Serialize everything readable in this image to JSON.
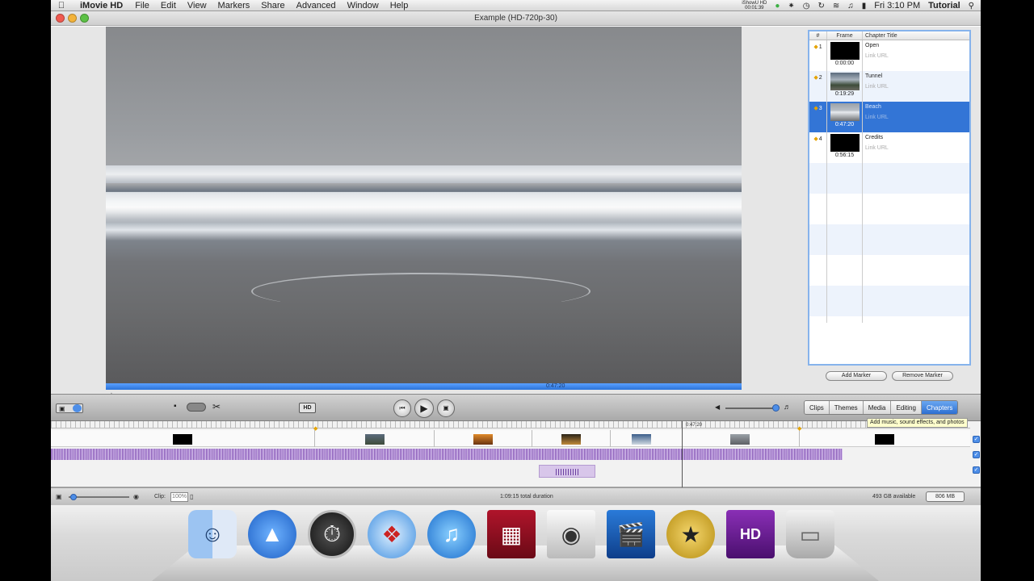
{
  "menubar": {
    "app_name": "iMovie HD",
    "items": [
      "File",
      "Edit",
      "View",
      "Markers",
      "Share",
      "Advanced",
      "Window",
      "Help"
    ],
    "ishowhd": "iShowU HD",
    "rec_time": "00:01:39",
    "clock": "Fri 3:10 PM",
    "user": "Tutorial"
  },
  "window": {
    "title": "Example (HD-720p-30)"
  },
  "viewer": {
    "scrub_time": "0:47:20"
  },
  "chapters": {
    "headers": {
      "num": "#",
      "frame": "Frame",
      "title": "Chapter Title"
    },
    "link_placeholder": "Link URL",
    "rows": [
      {
        "num": "1",
        "title": "Open",
        "time": "0:00:00"
      },
      {
        "num": "2",
        "title": "Tunnel",
        "time": "0:19:29"
      },
      {
        "num": "3",
        "title": "Beach",
        "time": "0:47:20"
      },
      {
        "num": "4",
        "title": "Credits",
        "time": "0:56:15"
      }
    ],
    "selected_index": 2,
    "add_marker": "Add Marker",
    "remove_marker": "Remove Marker"
  },
  "controls": {
    "hd_label": "HD",
    "tabs": [
      "Clips",
      "Themes",
      "Media",
      "Editing",
      "Chapters"
    ],
    "active_tab": "Chapters",
    "tooltip": "Add music, sound effects, and photos"
  },
  "timeline": {
    "playhead_time": "0:47:20"
  },
  "status": {
    "clip_label": "Clip:",
    "clip_zoom": "100%",
    "duration": "1:09:15 total duration",
    "disk": "493 GB available",
    "memory": "806 MB"
  },
  "dock": {
    "icons": [
      "finder-icon",
      "app-store-icon",
      "dashboard-icon",
      "safari-icon",
      "itunes-icon",
      "photo-booth-icon",
      "preview-icon",
      "final-cut-icon",
      "imovie-icon",
      "imovie-hd-icon",
      "trash-icon"
    ]
  }
}
